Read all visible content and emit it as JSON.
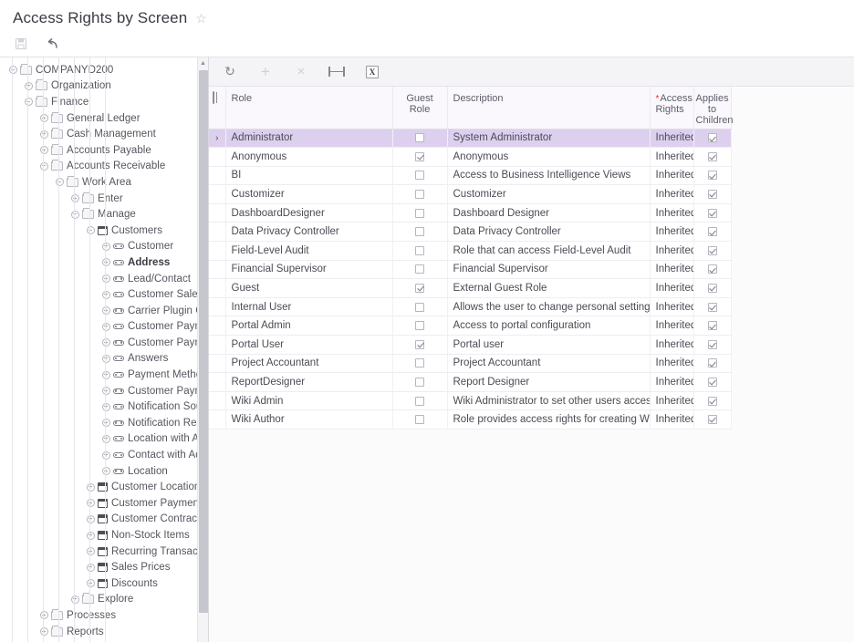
{
  "header": {
    "title": "Access Rights by Screen",
    "favorite_icon": "star-icon"
  },
  "page_toolbar": {
    "items": [
      {
        "name": "save-button",
        "icon": "save-icon",
        "glyph": "⬚",
        "disabled": true
      },
      {
        "name": "undo-button",
        "icon": "undo-icon",
        "glyph": "↶",
        "disabled": false
      }
    ]
  },
  "grid_toolbar": {
    "items": [
      {
        "name": "refresh-button",
        "icon": "refresh-icon",
        "glyph": "↻",
        "disabled": false
      },
      {
        "name": "add-row-button",
        "icon": "plus-icon",
        "glyph": "+",
        "disabled": true
      },
      {
        "name": "delete-row-button",
        "icon": "close-icon",
        "glyph": "×",
        "disabled": true
      },
      {
        "name": "fit-columns-button",
        "icon": "fit-columns-icon",
        "glyph": "",
        "disabled": false
      },
      {
        "name": "export-excel-button",
        "icon": "excel-icon",
        "glyph": "X",
        "disabled": false
      }
    ]
  },
  "tree": {
    "scroll_up_glyph": "▲",
    "nodes": [
      {
        "depth": 0,
        "label": "COMPANYD200",
        "toggle": "minus",
        "icon": "folder-icon",
        "bold": false
      },
      {
        "depth": 1,
        "label": "Organization",
        "toggle": "plus",
        "icon": "folder-icon",
        "bold": false
      },
      {
        "depth": 1,
        "label": "Finance",
        "toggle": "minus",
        "icon": "folder-icon",
        "bold": false
      },
      {
        "depth": 2,
        "label": "General Ledger",
        "toggle": "plus",
        "icon": "folder-icon",
        "bold": false
      },
      {
        "depth": 2,
        "label": "Cash Management",
        "toggle": "plus",
        "icon": "folder-icon",
        "bold": false
      },
      {
        "depth": 2,
        "label": "Accounts Payable",
        "toggle": "plus",
        "icon": "folder-icon",
        "bold": false
      },
      {
        "depth": 2,
        "label": "Accounts Receivable",
        "toggle": "minus",
        "icon": "folder-icon",
        "bold": false
      },
      {
        "depth": 3,
        "label": "Work Area",
        "toggle": "minus",
        "icon": "folder-icon",
        "bold": false
      },
      {
        "depth": 4,
        "label": "Enter",
        "toggle": "plus",
        "icon": "folder-icon",
        "bold": false
      },
      {
        "depth": 4,
        "label": "Manage",
        "toggle": "minus",
        "icon": "folder-icon",
        "bold": false
      },
      {
        "depth": 5,
        "label": "Customers",
        "toggle": "minus",
        "icon": "window-icon",
        "bold": false
      },
      {
        "depth": 6,
        "label": "Customer",
        "toggle": "plus",
        "icon": "field-icon",
        "bold": false
      },
      {
        "depth": 6,
        "label": "Address",
        "toggle": "plus",
        "icon": "field-icon",
        "bold": true
      },
      {
        "depth": 6,
        "label": "Lead/Contact",
        "toggle": "plus",
        "icon": "field-icon",
        "bold": false
      },
      {
        "depth": 6,
        "label": "Customer Salesperso",
        "toggle": "plus",
        "icon": "field-icon",
        "bold": false
      },
      {
        "depth": 6,
        "label": "Carrier Plugin Custor",
        "toggle": "plus",
        "icon": "field-icon",
        "bold": false
      },
      {
        "depth": 6,
        "label": "Customer Payment M",
        "toggle": "plus",
        "icon": "field-icon",
        "bold": false
      },
      {
        "depth": 6,
        "label": "Customer Payment M",
        "toggle": "plus",
        "icon": "field-icon",
        "bold": false
      },
      {
        "depth": 6,
        "label": "Answers",
        "toggle": "plus",
        "icon": "field-icon",
        "bold": false
      },
      {
        "depth": 6,
        "label": "Payment Method Det",
        "toggle": "plus",
        "icon": "field-icon",
        "bold": false
      },
      {
        "depth": 6,
        "label": "Customer Payment M",
        "toggle": "plus",
        "icon": "field-icon",
        "bold": false
      },
      {
        "depth": 6,
        "label": "Notification Source",
        "toggle": "plus",
        "icon": "field-icon",
        "bold": false
      },
      {
        "depth": 6,
        "label": "Notification Recipient",
        "toggle": "plus",
        "icon": "field-icon",
        "bold": false
      },
      {
        "depth": 6,
        "label": "Location with Addres",
        "toggle": "plus",
        "icon": "field-icon",
        "bold": false
      },
      {
        "depth": 6,
        "label": "Contact with Address",
        "toggle": "plus",
        "icon": "field-icon",
        "bold": false
      },
      {
        "depth": 6,
        "label": "Location",
        "toggle": "plus",
        "icon": "field-icon",
        "bold": false
      },
      {
        "depth": 5,
        "label": "Customer Locations",
        "toggle": "plus",
        "icon": "window-icon",
        "bold": false
      },
      {
        "depth": 5,
        "label": "Customer Payment Meth",
        "toggle": "plus",
        "icon": "window-icon",
        "bold": false
      },
      {
        "depth": 5,
        "label": "Customer Contracts",
        "toggle": "plus",
        "icon": "window-icon",
        "bold": false
      },
      {
        "depth": 5,
        "label": "Non-Stock Items",
        "toggle": "plus",
        "icon": "window-icon",
        "bold": false
      },
      {
        "depth": 5,
        "label": "Recurring Transactions",
        "toggle": "plus",
        "icon": "window-icon",
        "bold": false
      },
      {
        "depth": 5,
        "label": "Sales Prices",
        "toggle": "plus",
        "icon": "window-icon",
        "bold": false
      },
      {
        "depth": 5,
        "label": "Discounts",
        "toggle": "plus",
        "icon": "window-icon",
        "bold": false
      },
      {
        "depth": 4,
        "label": "Explore",
        "toggle": "plus",
        "icon": "folder-icon",
        "bold": false
      },
      {
        "depth": 2,
        "label": "Processes",
        "toggle": "plus",
        "icon": "folder-icon",
        "bold": false
      },
      {
        "depth": 2,
        "label": "Reports",
        "toggle": "plus",
        "icon": "folder-icon",
        "bold": false
      }
    ]
  },
  "grid": {
    "columns": [
      {
        "key": "role",
        "label": "Role",
        "required": false,
        "align": "left"
      },
      {
        "key": "guest",
        "label": "Guest Role",
        "required": false,
        "align": "center"
      },
      {
        "key": "description",
        "label": "Description",
        "required": false,
        "align": "left"
      },
      {
        "key": "rights",
        "label": "Access Rights",
        "required": true,
        "align": "left"
      },
      {
        "key": "children",
        "label": "Applies to Children",
        "required": false,
        "align": "center"
      }
    ],
    "selected_row_index": 0,
    "selected_row_marker": "›",
    "rows": [
      {
        "role": "Administrator",
        "guest": false,
        "description": "System Administrator",
        "rights": "Inherited",
        "children": true
      },
      {
        "role": "Anonymous",
        "guest": true,
        "description": "Anonymous",
        "rights": "Inherited",
        "children": true
      },
      {
        "role": "BI",
        "guest": false,
        "description": "Access to Business Intelligence Views",
        "rights": "Inherited",
        "children": true
      },
      {
        "role": "Customizer",
        "guest": false,
        "description": "Customizer",
        "rights": "Inherited",
        "children": true
      },
      {
        "role": "DashboardDesigner",
        "guest": false,
        "description": "Dashboard Designer",
        "rights": "Inherited",
        "children": true
      },
      {
        "role": "Data Privacy Controller",
        "guest": false,
        "description": "Data Privacy Controller",
        "rights": "Inherited",
        "children": true
      },
      {
        "role": "Field-Level Audit",
        "guest": false,
        "description": "Role that can access Field-Level Audit",
        "rights": "Inherited",
        "children": true
      },
      {
        "role": "Financial Supervisor",
        "guest": false,
        "description": "Financial Supervisor",
        "rights": "Inherited",
        "children": true
      },
      {
        "role": "Guest",
        "guest": true,
        "description": "External Guest Role",
        "rights": "Inherited",
        "children": true
      },
      {
        "role": "Internal User",
        "guest": false,
        "description": "Allows the user to change personal settings, a…",
        "rights": "Inherited",
        "children": true
      },
      {
        "role": "Portal Admin",
        "guest": false,
        "description": "Access to portal configuration",
        "rights": "Inherited",
        "children": true
      },
      {
        "role": "Portal User",
        "guest": true,
        "description": "Portal user",
        "rights": "Inherited",
        "children": true
      },
      {
        "role": "Project Accountant",
        "guest": false,
        "description": "Project Accountant",
        "rights": "Inherited",
        "children": true
      },
      {
        "role": "ReportDesigner",
        "guest": false,
        "description": "Report Designer",
        "rights": "Inherited",
        "children": true
      },
      {
        "role": "Wiki Admin",
        "guest": false,
        "description": "Wiki Administrator to set other users access ri…",
        "rights": "Inherited",
        "children": true
      },
      {
        "role": "Wiki Author",
        "guest": false,
        "description": "Role provides access rights for creating Wiki a…",
        "rights": "Inherited",
        "children": true
      }
    ]
  },
  "colors": {
    "selection": "#ddd0ee",
    "header_bg": "#faf8fc",
    "required": "#d2323c",
    "toolbar_bg": "#f4f4f6"
  }
}
